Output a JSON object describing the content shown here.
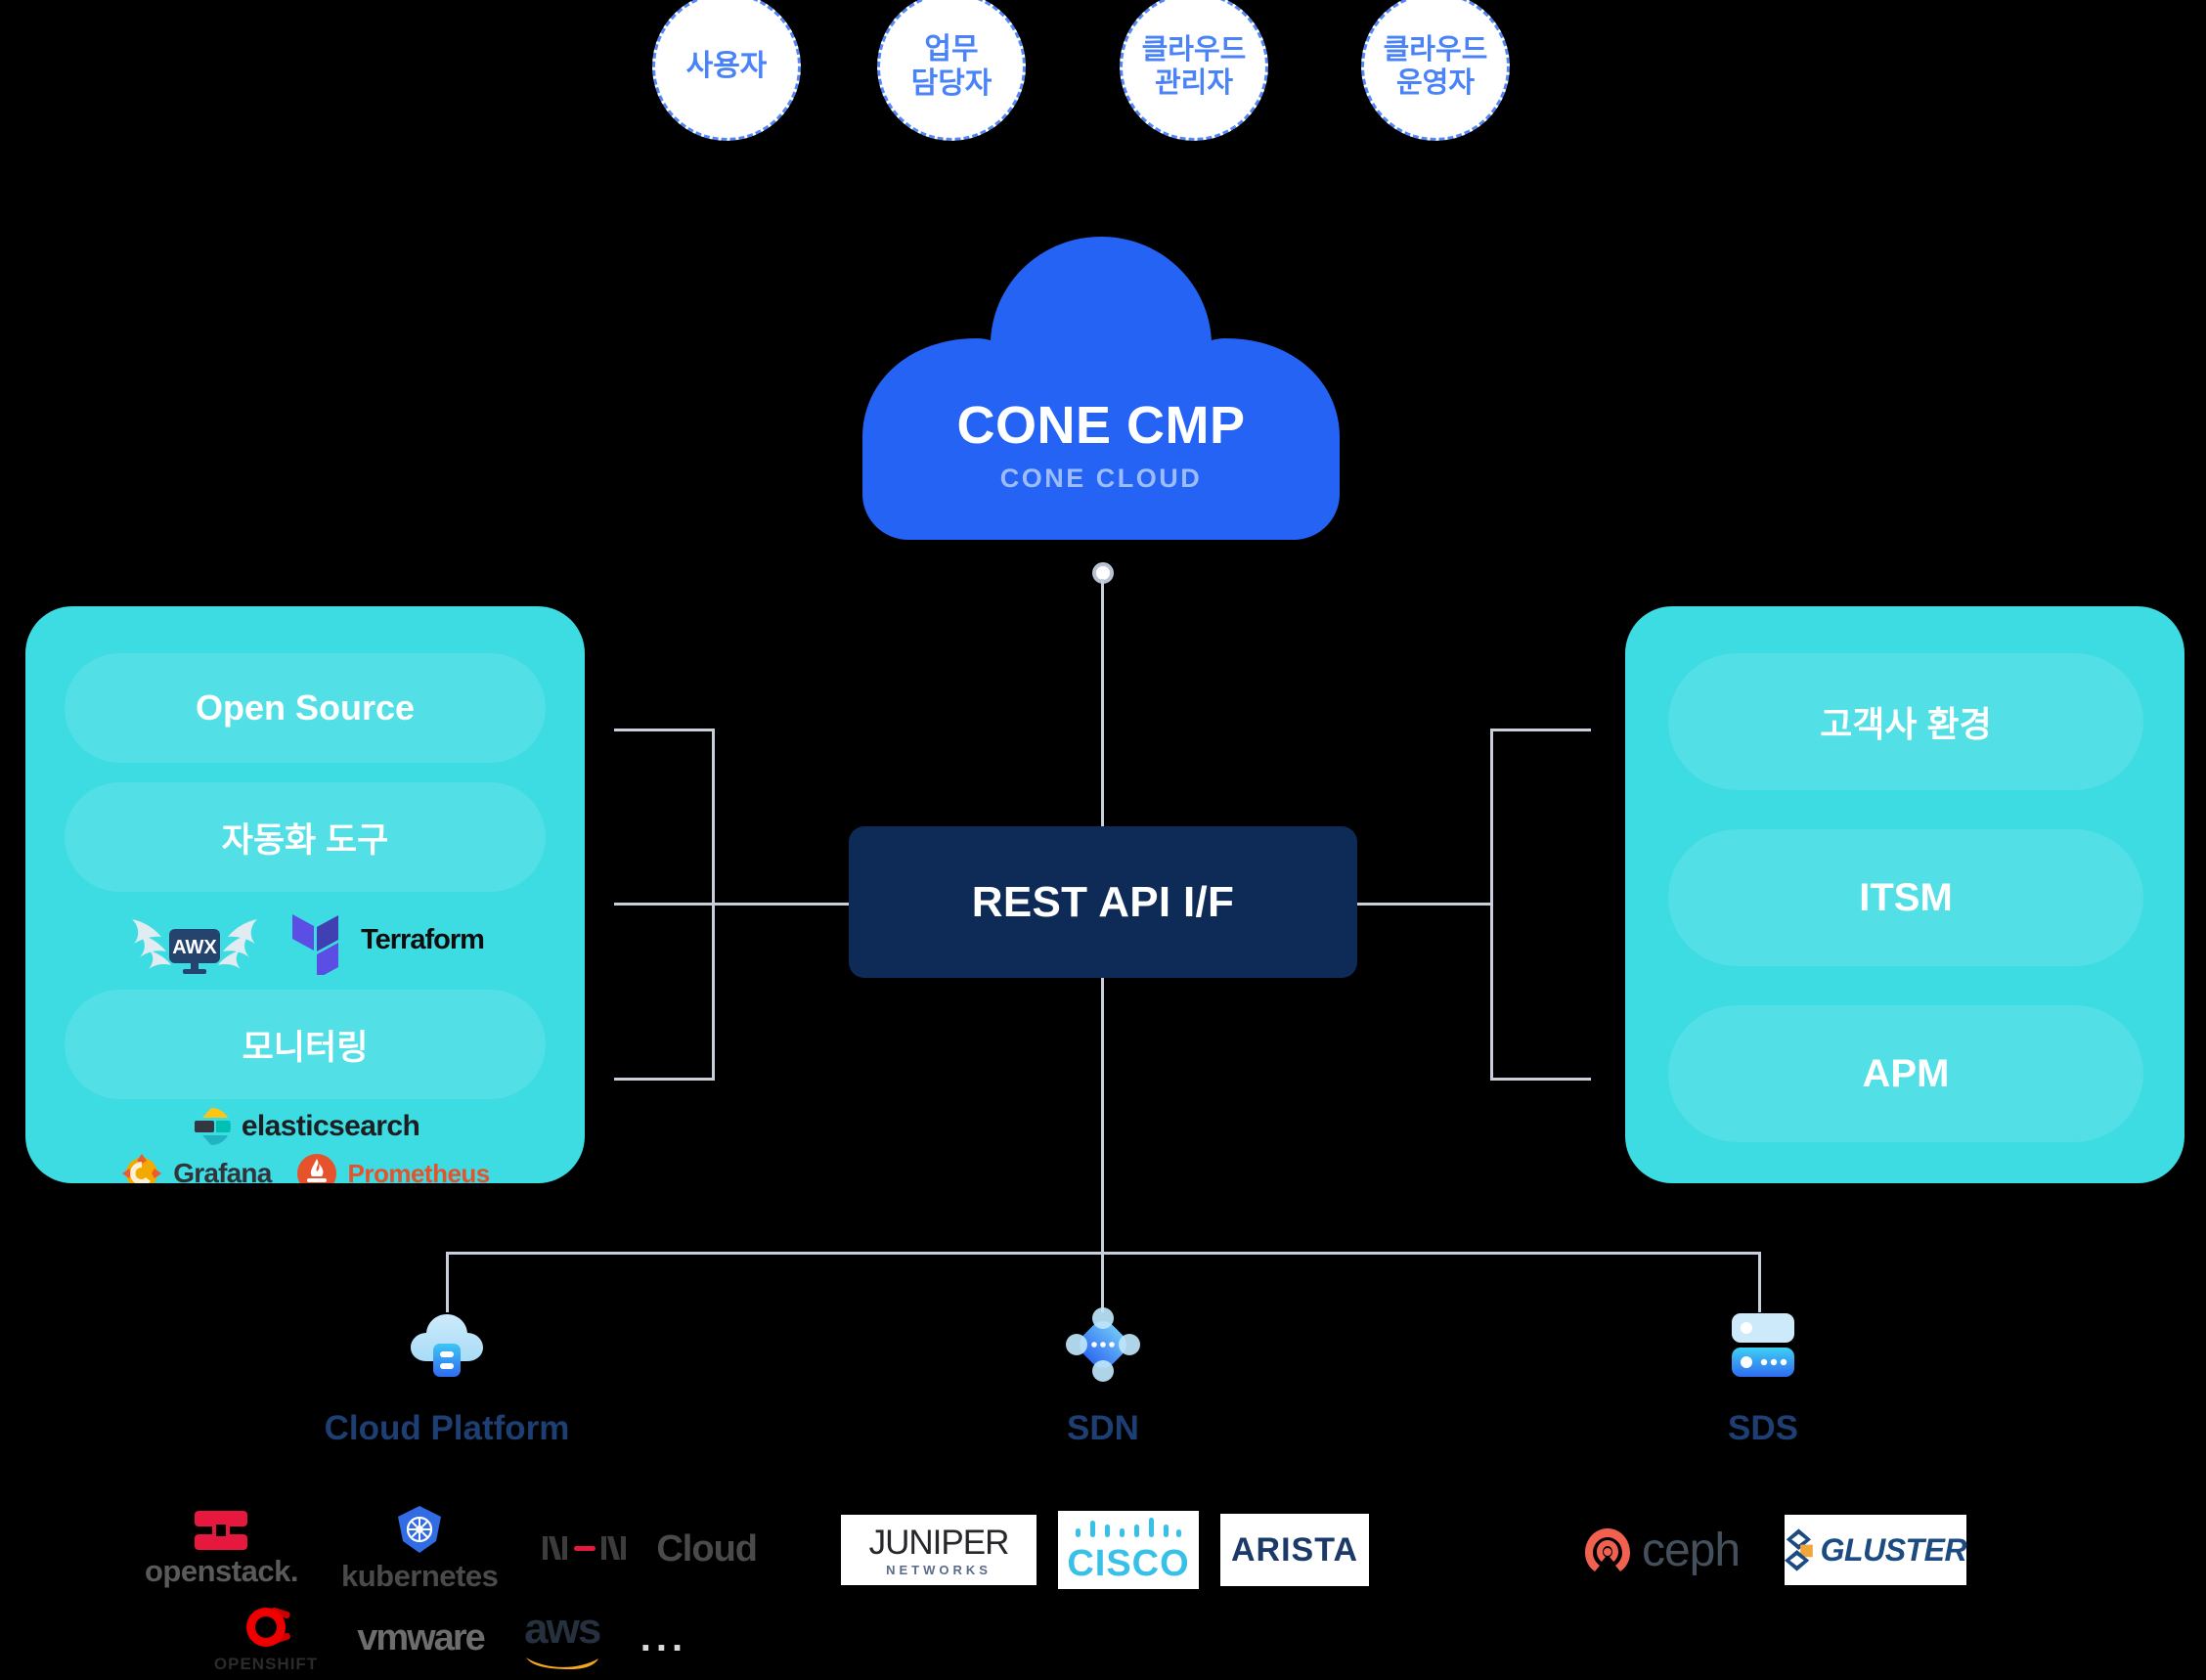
{
  "background_color": "#000000",
  "personas": {
    "items": [
      {
        "label": "사용자",
        "name": "persona-user"
      },
      {
        "label": "업무\n담당자",
        "line1": "업무",
        "line2": "담당자",
        "name": "persona-business-manager"
      },
      {
        "label": "클라우드\n관리자",
        "line1": "클라우드",
        "line2": "관리자",
        "name": "persona-cloud-admin"
      },
      {
        "label": "클라우드\n운영자",
        "line1": "클라우드",
        "line2": "운영자",
        "name": "persona-cloud-operator"
      }
    ],
    "border_color": "#5588f7",
    "text_color": "#4a83f7"
  },
  "cloud": {
    "title": "CONE CMP",
    "subtitle": "CONE CLOUD",
    "color": "#2563f5",
    "subtitle_color": "#9dbcfb"
  },
  "api": {
    "label": "REST API I/F",
    "color": "#0e2a57"
  },
  "left_panel": {
    "color": "#3ddbe2",
    "sections": [
      {
        "label": "Open Source",
        "name": "open-source-pill"
      },
      {
        "label": "자동화 도구",
        "name": "automation-tools-pill"
      },
      {
        "label": "모니터링",
        "name": "monitoring-pill"
      }
    ],
    "automation_logos": [
      {
        "label": "AWX",
        "name": "awx-logo"
      },
      {
        "label": "Terraform",
        "name": "terraform-logo"
      }
    ],
    "monitoring_logos": [
      {
        "label": "elasticsearch",
        "name": "elasticsearch-logo"
      },
      {
        "label": "Grafana",
        "name": "grafana-logo"
      },
      {
        "label": "Prometheus",
        "name": "prometheus-logo"
      }
    ]
  },
  "right_panel": {
    "color": "#3ddbe2",
    "sections": [
      {
        "label": "고객사 환경",
        "name": "customer-env-pill"
      },
      {
        "label": "ITSM",
        "name": "itsm-pill"
      },
      {
        "label": "APM",
        "name": "apm-pill"
      }
    ]
  },
  "categories": [
    {
      "label": "Cloud Platform",
      "icon": "cloud-server-icon",
      "vendors": [
        "openstack.",
        "kubernetes",
        "NHN Cloud",
        "OPENSHIFT",
        "vmware",
        "aws",
        "..."
      ]
    },
    {
      "label": "SDN",
      "icon": "network-node-icon",
      "vendors": [
        "JUNIPER",
        "NETWORKS",
        "CISCO",
        "ARISTA"
      ]
    },
    {
      "label": "SDS",
      "icon": "storage-stack-icon",
      "vendors": [
        "ceph",
        "GLUSTER"
      ]
    }
  ],
  "category_label_color": "#1d3f74",
  "connector_color": "#c9cfda"
}
